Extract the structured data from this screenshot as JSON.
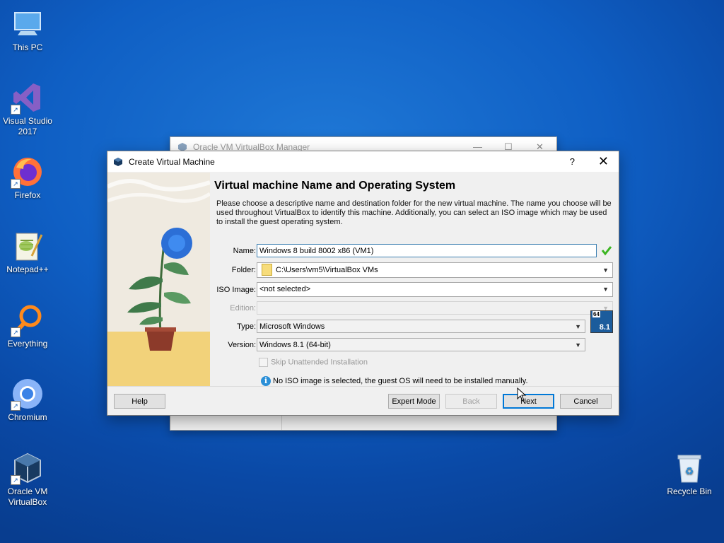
{
  "desktop": {
    "icons": [
      {
        "label": "This PC"
      },
      {
        "label": "Visual Studio 2017"
      },
      {
        "label": "Firefox"
      },
      {
        "label": "Notepad++"
      },
      {
        "label": "Everything"
      },
      {
        "label": "Chromium"
      },
      {
        "label": "Oracle VM VirtualBox"
      },
      {
        "label": "Recycle Bin"
      }
    ]
  },
  "manager_window": {
    "title": "Oracle VM VirtualBox Manager"
  },
  "dialog": {
    "title": "Create Virtual Machine",
    "help_glyph": "?",
    "close_glyph": "✕",
    "heading": "Virtual machine Name and Operating System",
    "description": "Please choose a descriptive name and destination folder for the new virtual machine. The name you choose will be used throughout VirtualBox to identify this machine. Additionally, you can select an ISO image which may be used to install the guest operating system.",
    "fields": {
      "name": {
        "label": "Name:",
        "value": "Windows 8 build 8002 x86 (VM1)"
      },
      "folder": {
        "label": "Folder:",
        "value": "C:\\Users\\vm5\\VirtualBox VMs"
      },
      "iso_image": {
        "label": "ISO Image:",
        "value": "<not selected>"
      },
      "edition": {
        "label": "Edition:",
        "value": ""
      },
      "type": {
        "label": "Type:",
        "value": "Microsoft Windows"
      },
      "version": {
        "label": "Version:",
        "value": "Windows 8.1 (64-bit)"
      }
    },
    "os_badge": {
      "top": "64",
      "bottom": "8.1"
    },
    "skip_unattended": {
      "label": "Skip Unattended Installation",
      "checked": false
    },
    "info_message": "No ISO image is selected, the guest OS will need to be installed manually.",
    "buttons": {
      "help": "Help",
      "expert_mode": "Expert Mode",
      "back": "Back",
      "next": "Next",
      "cancel": "Cancel"
    }
  },
  "colors": {
    "desktop_blue": "#0f5fc4",
    "accent_blue": "#0078d7",
    "valid_green": "#3cb521"
  }
}
